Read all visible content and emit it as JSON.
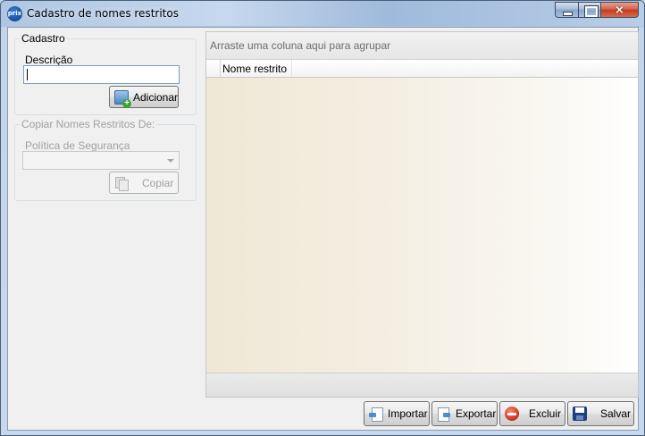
{
  "window": {
    "title": "Cadastro de nomes restritos",
    "icon_text": "prix",
    "close_glyph": "×"
  },
  "cadastro": {
    "legend": "Cadastro",
    "descricao_label": "Descrição",
    "descricao_value": "",
    "add_button": "Adicionar"
  },
  "copiar": {
    "legend": "Copiar Nomes Restritos De:",
    "politica_label": "Política de Segurança",
    "politica_value": "",
    "copy_button": "Copiar"
  },
  "grid": {
    "group_panel_text": "Arraste uma coluna aqui para agrupar",
    "columns": [
      "Nome restrito"
    ],
    "rows": []
  },
  "actions": {
    "importar": "Importar",
    "exportar": "Exportar",
    "excluir": "Excluir",
    "salvar": "Salvar"
  }
}
